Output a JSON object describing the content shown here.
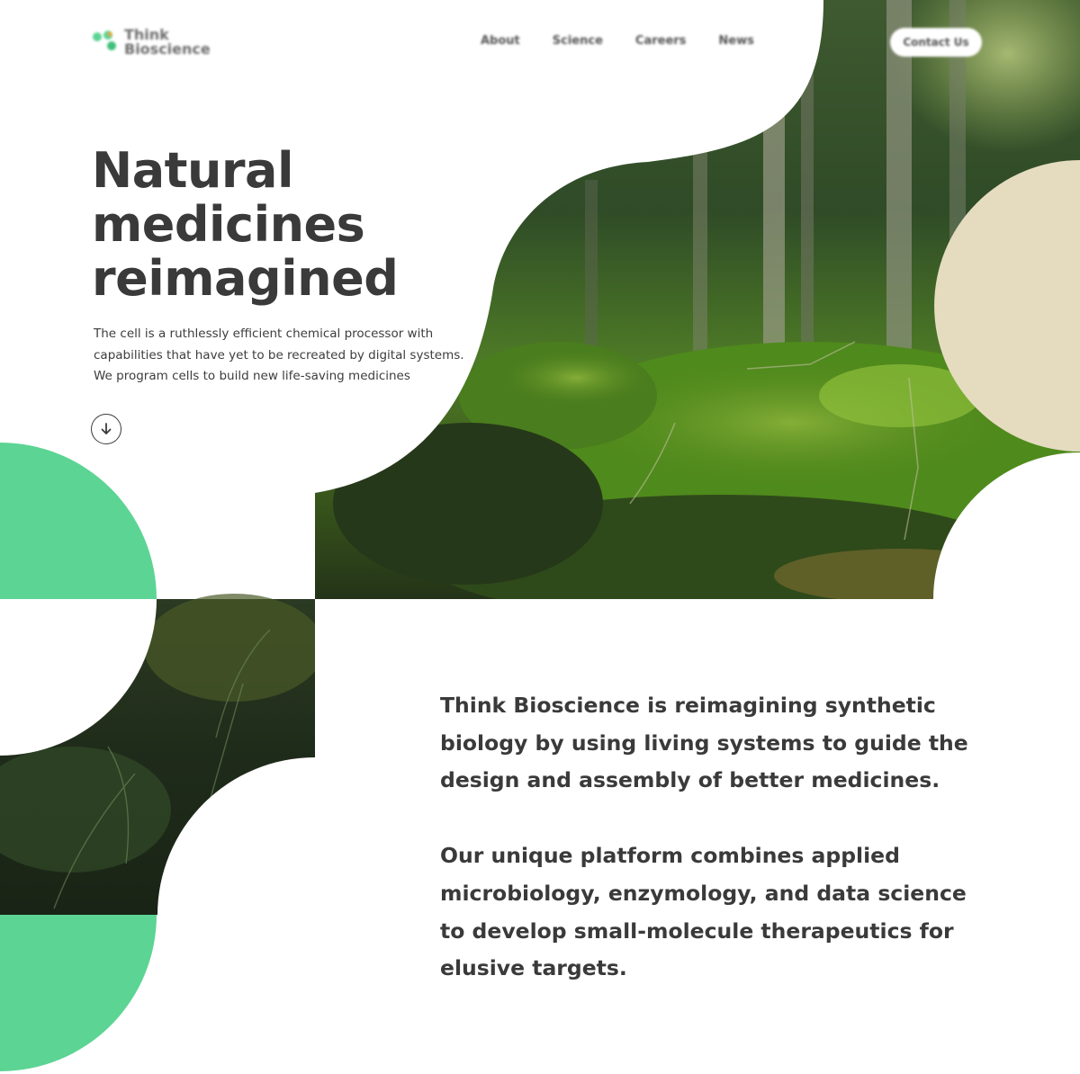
{
  "brand": {
    "name_line1": "Think",
    "name_line2": "Bioscience",
    "logo_icon": "molecule-logo-icon"
  },
  "nav": {
    "items": [
      {
        "label": "About"
      },
      {
        "label": "Science"
      },
      {
        "label": "Careers"
      },
      {
        "label": "News"
      }
    ],
    "contact_label": "Contact Us"
  },
  "hero": {
    "title_lines": [
      "Natural",
      "medicines",
      "reimagined"
    ],
    "description_lines": [
      "The cell is a ruthlessly efficient chemical processor with",
      "capabilities that have yet to be recreated by digital systems.",
      "We program cells to build new life-saving medicines"
    ],
    "scroll_icon": "arrow-down-circle-icon"
  },
  "about": {
    "paragraph1_lines": [
      "Think Bioscience is reimagining synthetic",
      "biology by using living systems to guide the",
      "design and assembly of better medicines."
    ],
    "paragraph2_lines": [
      "Our unique platform combines applied",
      "microbiology, enzymology, and data science",
      "to develop small-molecule therapeutics for",
      "elusive targets."
    ]
  },
  "colors": {
    "accent_green": "#5cd494",
    "sand": "#e5dcc0",
    "text_dark": "#3a3a3a",
    "background": "#ffffff"
  }
}
